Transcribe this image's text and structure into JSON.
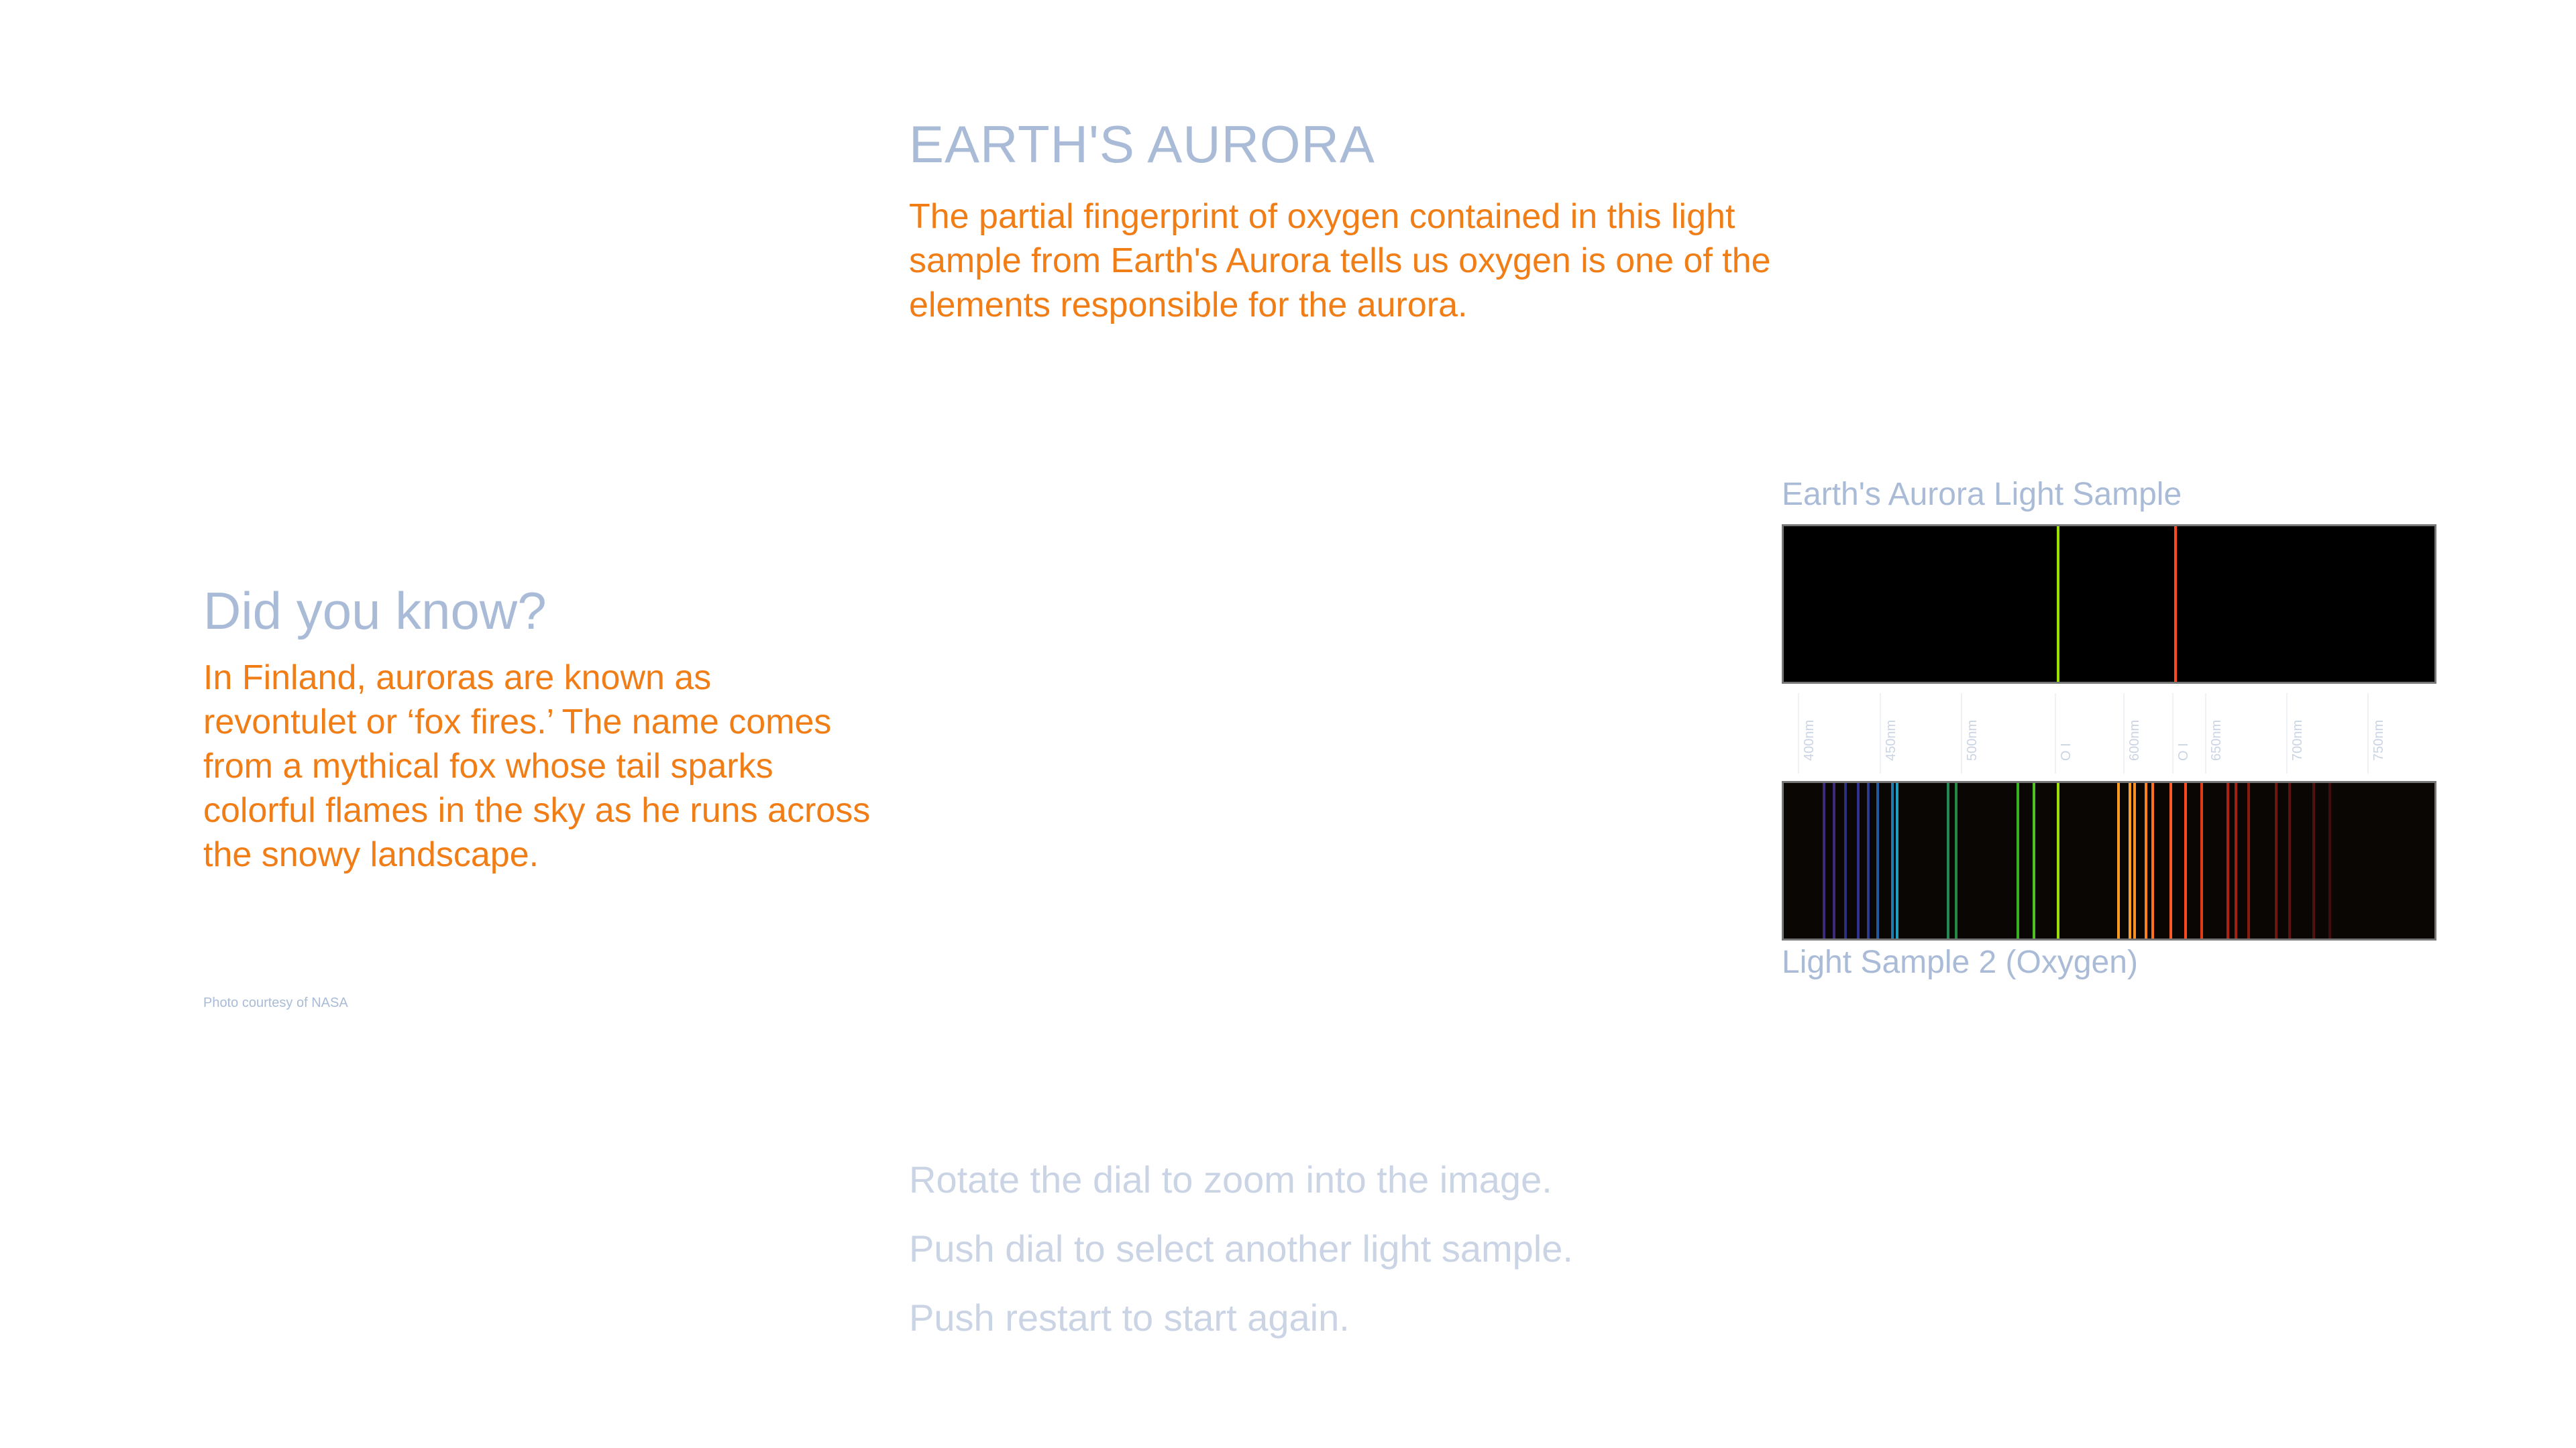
{
  "header": {
    "title": "EARTH'S AURORA",
    "description": "The partial fingerprint of oxygen contained in this light sample from Earth's Aurora tells us oxygen is one of the elements responsible for the aurora."
  },
  "did_you_know": {
    "title": "Did you know?",
    "text": "In Finland, auroras are known as revontulet or ‘fox fires.’ The name comes from a mythical fox whose tail sparks colorful flames in the sky as he runs across the snowy landscape.",
    "credit": "Photo courtesy of NASA"
  },
  "instructions": [
    "Rotate the dial to zoom into the image.",
    "Push dial to select another light sample.",
    "Push restart to start again."
  ],
  "spectra": {
    "sample1_label": "Earth's Aurora Light Sample",
    "sample2_label": "Light Sample 2 (Oxygen)",
    "scale": {
      "min_nm": 390,
      "max_nm": 790,
      "ticks": [
        {
          "nm": 400,
          "label": "400nm"
        },
        {
          "nm": 450,
          "label": "450nm"
        },
        {
          "nm": 500,
          "label": "500nm"
        },
        {
          "nm": 557.7,
          "label": "O I"
        },
        {
          "nm": 600,
          "label": "600nm"
        },
        {
          "nm": 630,
          "label": "O I"
        },
        {
          "nm": 650,
          "label": "650nm"
        },
        {
          "nm": 700,
          "label": "700nm"
        },
        {
          "nm": 750,
          "label": "750nm"
        }
      ]
    },
    "sample1_lines": [
      {
        "nm": 557.7,
        "color": "#9be000"
      },
      {
        "nm": 630.0,
        "color": "#ff4a20"
      }
    ],
    "sample2_lines": [
      {
        "nm": 414,
        "color": "#3a2a7a"
      },
      {
        "nm": 420,
        "color": "#3a2a7a"
      },
      {
        "nm": 427,
        "color": "#2c2e80"
      },
      {
        "nm": 435,
        "color": "#2c3490"
      },
      {
        "nm": 441,
        "color": "#2c3a90"
      },
      {
        "nm": 447,
        "color": "#1f5aa0"
      },
      {
        "nm": 456,
        "color": "#1a7fb0"
      },
      {
        "nm": 459,
        "color": "#1fa0c0"
      },
      {
        "nm": 490,
        "color": "#1f8a50"
      },
      {
        "nm": 495,
        "color": "#1f8a40"
      },
      {
        "nm": 533,
        "color": "#3ab020"
      },
      {
        "nm": 543,
        "color": "#50c020"
      },
      {
        "nm": 557.7,
        "color": "#9be000"
      },
      {
        "nm": 595,
        "color": "#ff9a20"
      },
      {
        "nm": 602,
        "color": "#ffa020"
      },
      {
        "nm": 605,
        "color": "#ff9020"
      },
      {
        "nm": 612,
        "color": "#ff8020"
      },
      {
        "nm": 616,
        "color": "#ff7020"
      },
      {
        "nm": 627,
        "color": "#ff5a20"
      },
      {
        "nm": 636,
        "color": "#ff4a20"
      },
      {
        "nm": 646,
        "color": "#e03a18"
      },
      {
        "nm": 662,
        "color": "#b02010"
      },
      {
        "nm": 667,
        "color": "#a02010"
      },
      {
        "nm": 675,
        "color": "#8a1a10"
      },
      {
        "nm": 692,
        "color": "#701510"
      },
      {
        "nm": 700,
        "color": "#601210"
      },
      {
        "nm": 715,
        "color": "#501010"
      },
      {
        "nm": 725,
        "color": "#400c0c"
      }
    ]
  }
}
